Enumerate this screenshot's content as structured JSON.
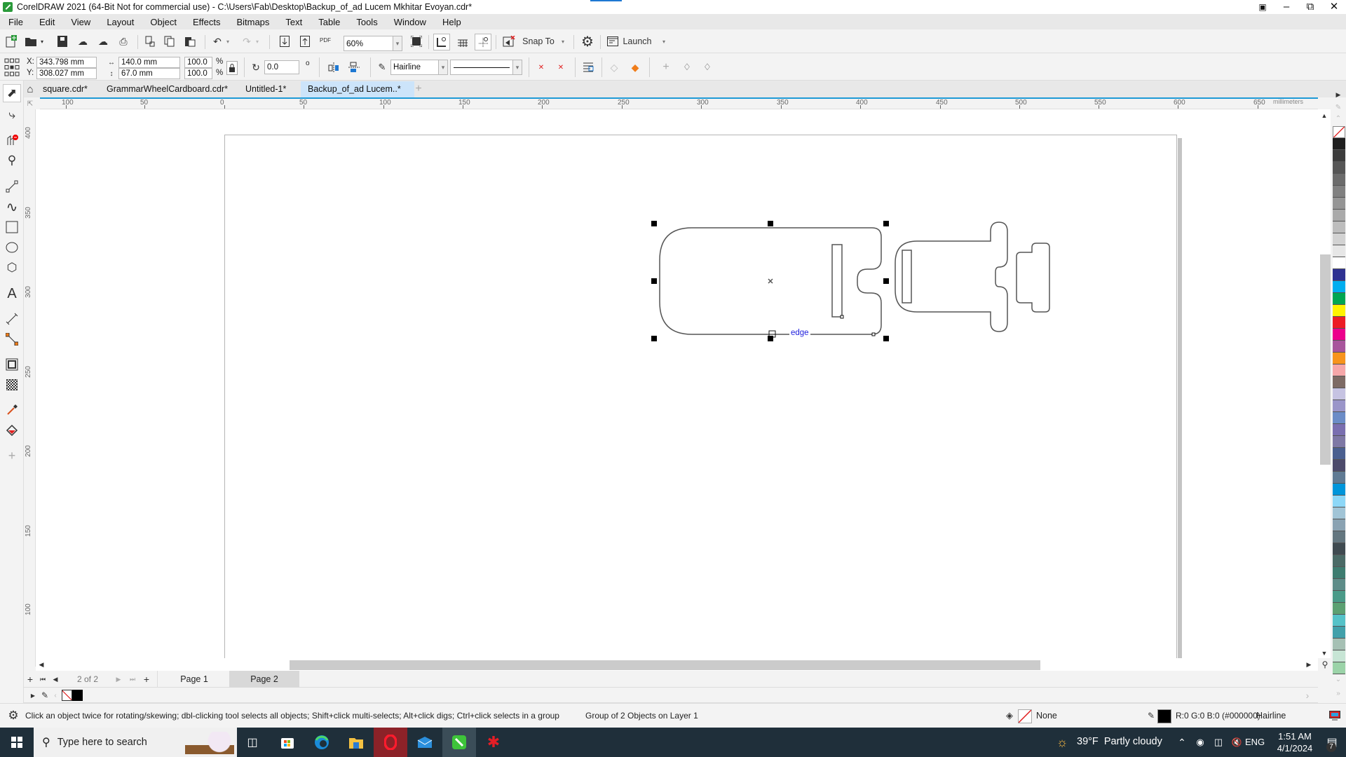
{
  "app": {
    "title": "CorelDRAW 2021 (64-Bit Not for commercial use) - C:\\Users\\Fab\\Desktop\\Backup_of_ad Lucem Mkhitar Evoyan.cdr*",
    "window_buttons": [
      "–",
      "⧉",
      "✕"
    ]
  },
  "menu": [
    "File",
    "Edit",
    "View",
    "Layout",
    "Object",
    "Effects",
    "Bitmaps",
    "Text",
    "Table",
    "Tools",
    "Window",
    "Help"
  ],
  "standard_toolbar": {
    "zoom_level": "60%",
    "snap_to_label": "Snap To",
    "launch_label": "Launch",
    "pdf_label": "PDF"
  },
  "property_bar": {
    "x": "343.798 mm",
    "y": "308.027 mm",
    "x_label": "X:",
    "y_label": "Y:",
    "width": "140.0 mm",
    "height": "67.0 mm",
    "scale_x": "100.0",
    "scale_y": "100.0",
    "percent": "%",
    "rotation": "0.0",
    "degree_symbol": "o",
    "outline_width": "Hairline"
  },
  "doc_tabs": [
    {
      "label": "square.cdr*",
      "active": false
    },
    {
      "label": "GrammarWheelCardboard.cdr*",
      "active": false
    },
    {
      "label": "Untitled-1*",
      "active": false
    },
    {
      "label": "Backup_of_ad Lucem..*",
      "active": true
    }
  ],
  "ruler": {
    "unit": "millimeters",
    "h_ticks": [
      "100",
      "50",
      "0",
      "50",
      "100",
      "150",
      "200",
      "250",
      "300",
      "350",
      "400",
      "450",
      "500",
      "550",
      "600",
      "650"
    ],
    "v_ticks": [
      "400",
      "350",
      "300",
      "250",
      "200",
      "150",
      "100"
    ]
  },
  "canvas": {
    "snap_hint": "edge"
  },
  "page_nav": {
    "counter": "2 of 2",
    "pages": [
      {
        "label": "Page 1",
        "active": false
      },
      {
        "label": "Page 2",
        "active": true
      }
    ]
  },
  "status": {
    "hint": "Click an object twice for rotating/skewing; dbl-clicking tool selects all objects; Shift+click multi-selects; Alt+click digs; Ctrl+click selects in a group",
    "selection": "Group of 2 Objects on Layer 1",
    "fill": "None",
    "outline_color": "R:0 G:0 B:0 (#000000)",
    "outline_width": "Hairline"
  },
  "palette": {
    "colors": [
      "#1e1e1e",
      "#3c3c3c",
      "#555555",
      "#6b6b6b",
      "#808080",
      "#959595",
      "#aaaaaa",
      "#bdbdbd",
      "#d2d2d2",
      "#e6e6e6",
      "#ffffff",
      "#2e3192",
      "#00aeef",
      "#00a651",
      "#fff200",
      "#ed1c24",
      "#ec008c",
      "#a8559c",
      "#f7941d",
      "#f6a7a9",
      "#7d6a64",
      "#c6c3e2",
      "#9a95c9",
      "#6b8cc7",
      "#7a6fb0",
      "#7e78a5",
      "#4a5f8f",
      "#4c4a6b",
      "#5f7a93",
      "#0095da",
      "#8dd7f7",
      "#a1c4d6",
      "#8aa2b2",
      "#63767f",
      "#3f4a50",
      "#4a6a66",
      "#3d7c70",
      "#5d8c88",
      "#4a9a88",
      "#5ca072",
      "#55c2c8",
      "#41a0aa",
      "#a6c0b4",
      "#c7e5d5",
      "#9bd3a8"
    ]
  },
  "taskbar": {
    "search_placeholder": "Type here to search",
    "weather": "39°F  Partly cloudy",
    "language": "ENG",
    "time": "1:51 AM",
    "date": "4/1/2024",
    "notifications": "7"
  }
}
